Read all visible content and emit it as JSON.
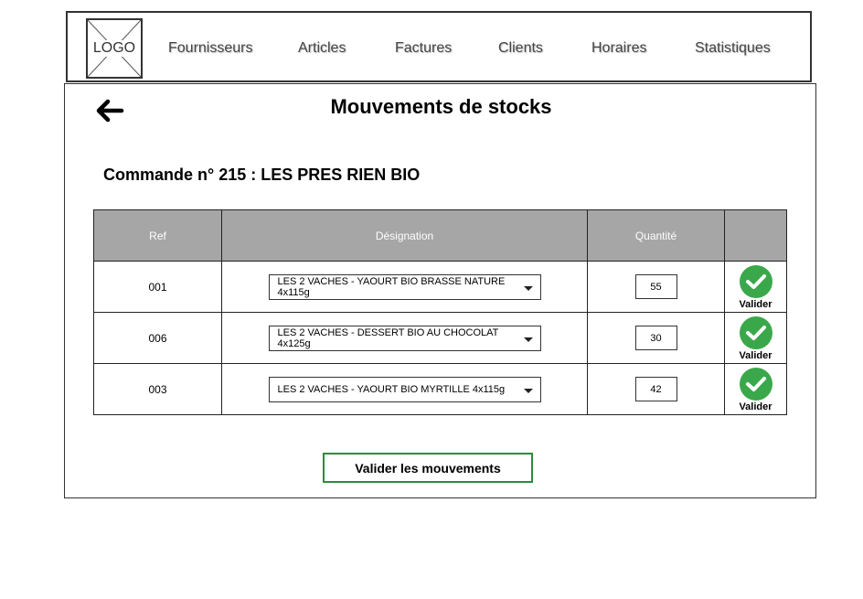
{
  "nav": {
    "logo": "LOGO",
    "items": [
      "Fournisseurs",
      "Articles",
      "Factures",
      "Clients",
      "Horaires",
      "Statistiques"
    ]
  },
  "page": {
    "title": "Mouvements de stocks",
    "back_icon": "arrow-left-icon"
  },
  "order": {
    "title": "Commande n° 215 : LES PRES RIEN BIO"
  },
  "table": {
    "headers": [
      "Ref",
      "Désignation",
      "Quantité",
      ""
    ],
    "rows": [
      {
        "ref": "001",
        "designation": "LES 2 VACHES - YAOURT BIO BRASSE NATURE 4x115g",
        "quantity": "55",
        "validate": "Valider"
      },
      {
        "ref": "006",
        "designation": "LES 2 VACHES - DESSERT BIO AU CHOCOLAT 4x125g",
        "quantity": "30",
        "validate": "Valider"
      },
      {
        "ref": "003",
        "designation": "LES 2 VACHES - YAOURT BIO MYRTILLE 4x115g",
        "quantity": "42",
        "validate": "Valider"
      }
    ]
  },
  "actions": {
    "submit_label": "Valider les mouvements"
  },
  "colors": {
    "header_bg": "#a6a6a6",
    "validate_green": "#3aa84a",
    "submit_border": "#2e8b3d"
  }
}
